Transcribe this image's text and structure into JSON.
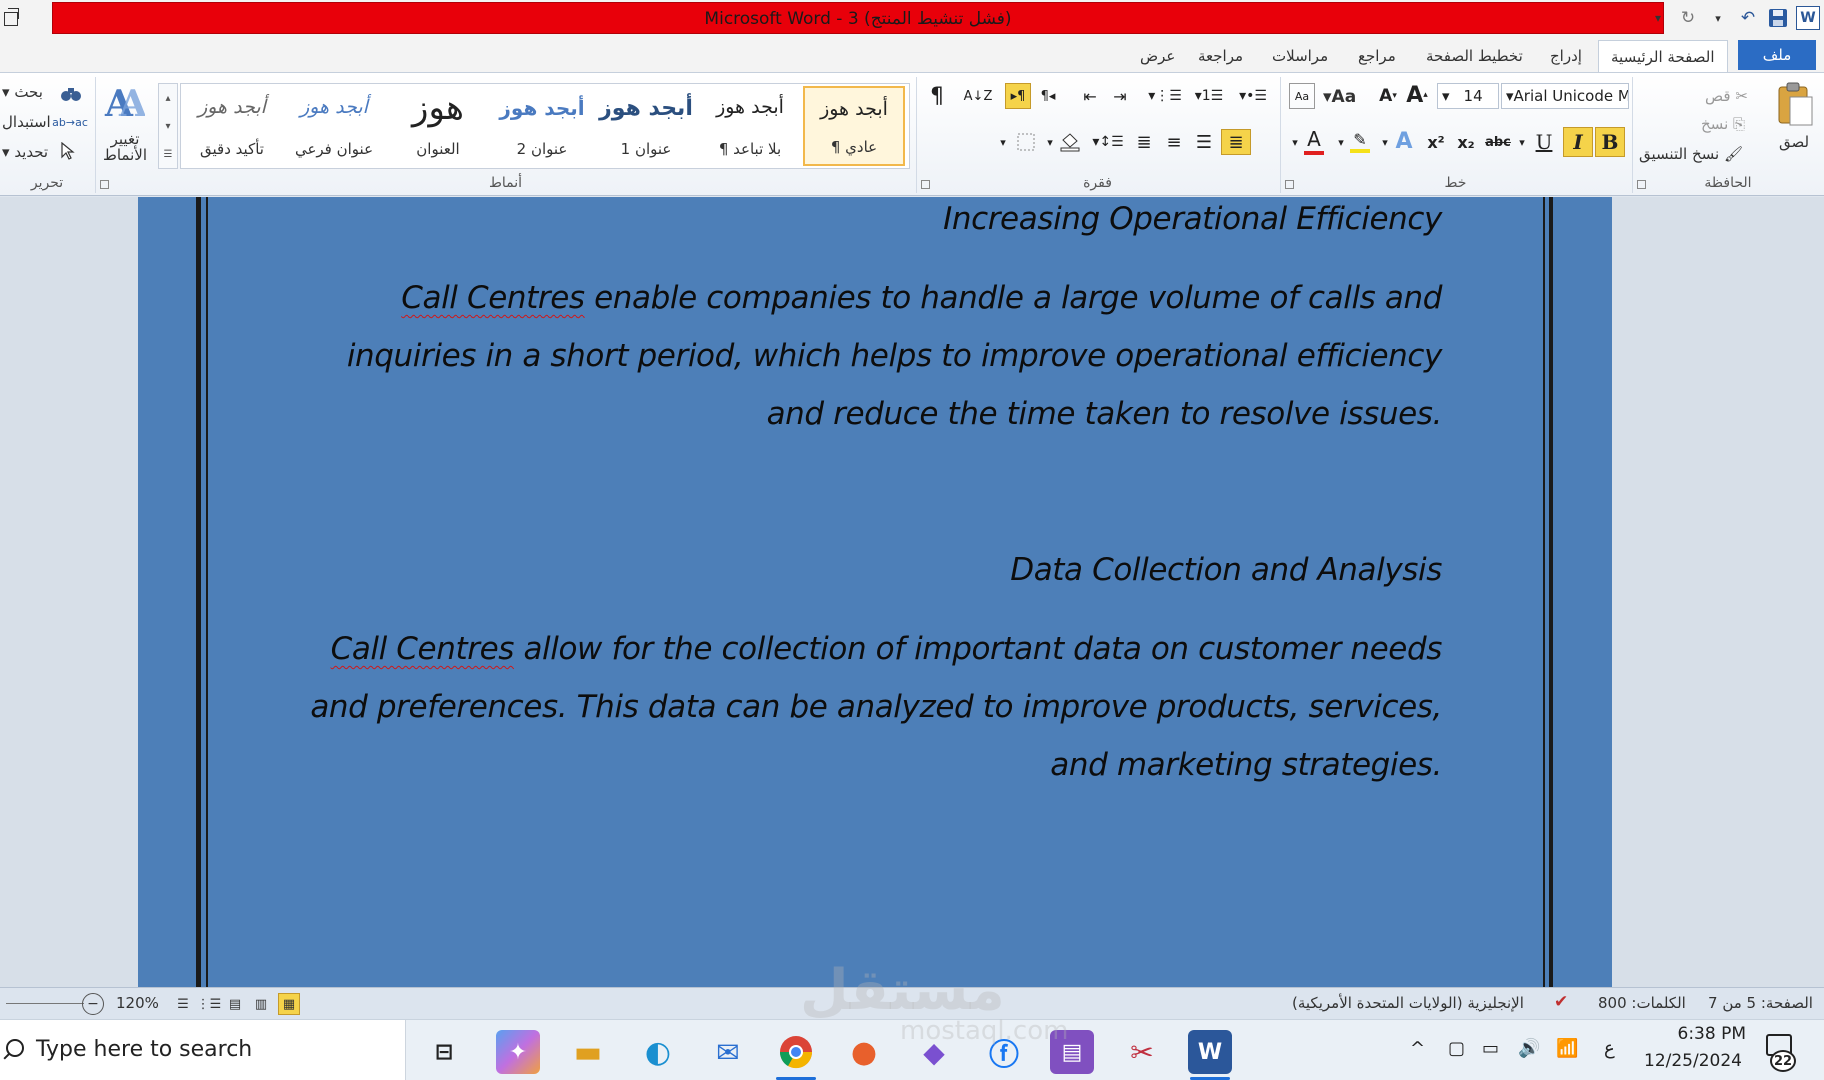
{
  "window": {
    "title": "Microsoft Word - 3 (فشل تنشيط المنتج)"
  },
  "qat": {
    "word_icon": "W",
    "save_icon": "save-icon",
    "undo_icon": "undo-icon",
    "redo_icon": "redo-icon",
    "dropdown": "▾"
  },
  "tabs": {
    "file": "ملف",
    "home": "الصفحة الرئيسية",
    "insert": "إدراج",
    "page_layout": "تخطيط الصفحة",
    "references": "مراجع",
    "mailings": "مراسلات",
    "review": "مراجعة",
    "view": "عرض"
  },
  "clipboard": {
    "paste": "لصق",
    "cut": "قص",
    "copy": "نسخ",
    "format_painter": "نسخ التنسيق",
    "label": "الحافظة"
  },
  "font": {
    "name": "Arial Unicode M",
    "size": "14",
    "bold": "B",
    "italic": "I",
    "underline": "U",
    "strike": "abc",
    "subscript": "x₂",
    "superscript": "x²",
    "grow": "A",
    "shrink": "A",
    "change_case": "Aa",
    "font_color": "A",
    "text_effects": "A",
    "label": "خط",
    "accent_color": "#f5d34a"
  },
  "paragraph": {
    "label": "فقرة",
    "pilcrow": "¶"
  },
  "styles": {
    "label": "أنماط",
    "items": [
      {
        "sample": "أبجد هوز",
        "name": "¶ عادي"
      },
      {
        "sample": "أبجد هوز",
        "name": "¶ بلا تباعد"
      },
      {
        "sample": "أبجد هوز",
        "name": "عنوان 1"
      },
      {
        "sample": "أبجد هوز",
        "name": "عنوان 2"
      },
      {
        "sample": "هوز",
        "name": "العنوان"
      },
      {
        "sample": "أبجد هوز",
        "name": "عنوان فرعي"
      },
      {
        "sample": "أبجد هوز",
        "name": "تأكيد دقيق"
      }
    ],
    "change_styles": "تغيير الأنماط"
  },
  "editing": {
    "find": "بحث",
    "replace": "استبدال",
    "select": "تحديد",
    "label": "تحرير"
  },
  "document": {
    "background_color": "#4d7fb8",
    "lines": [
      {
        "text": "Increasing Operational Efficiency",
        "squiggle": ""
      },
      {
        "text": " enable companies to handle a large volume of calls and",
        "squiggle": "Call Centres"
      },
      {
        "text": "inquiries in a short period, which helps to improve operational efficiency",
        "squiggle": ""
      },
      {
        "text": "and reduce the time taken to resolve issues.",
        "squiggle": ""
      },
      {
        "text": "Data Collection and Analysis",
        "squiggle": ""
      },
      {
        "text": " allow for the collection of important data on customer needs",
        "squiggle": "Call Centres"
      },
      {
        "text": "and preferences. This data can be analyzed to improve products, services,",
        "squiggle": ""
      },
      {
        "text": "and marketing strategies.",
        "squiggle": ""
      }
    ]
  },
  "statusbar": {
    "page": "الصفحة: 5 من 7",
    "words": "الكلمات: 800",
    "language": "الإنجليزية (الولايات المتحدة الأمريكية)",
    "zoom": "120%"
  },
  "taskbar": {
    "search_placeholder": "Type here to search",
    "time": "6:38 PM",
    "date": "12/25/2024",
    "input_lang": "ع",
    "notifications": "22"
  },
  "watermark": {
    "main": "مستقل",
    "sub": "mostaql.com"
  }
}
